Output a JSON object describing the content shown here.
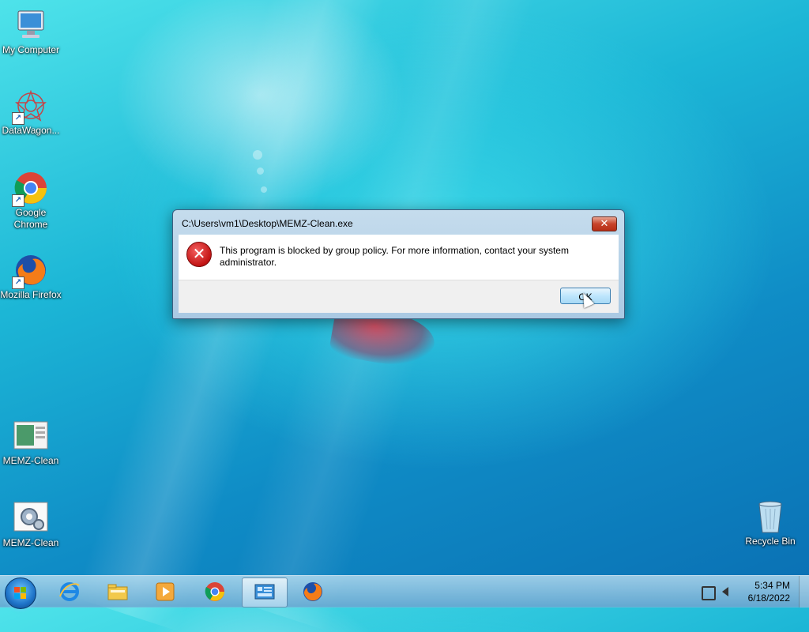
{
  "desktop": {
    "icons": [
      {
        "label": "My Computer",
        "icon": "computer-icon"
      },
      {
        "label": "DataWagon...",
        "icon": "datawagon-icon"
      },
      {
        "label": "Google Chrome",
        "icon": "chrome-icon"
      },
      {
        "label": "Mozilla Firefox",
        "icon": "firefox-icon"
      },
      {
        "label": "MEMZ-Clean",
        "icon": "memz-window-icon"
      },
      {
        "label": "MEMZ-Clean",
        "icon": "memz-gear-icon"
      },
      {
        "label": "Recycle Bin",
        "icon": "recycle-bin-icon"
      }
    ]
  },
  "dialog": {
    "title": "C:\\Users\\vm1\\Desktop\\MEMZ-Clean.exe",
    "close_glyph": "✕",
    "message": "This program is blocked by group policy. For more information, contact your system administrator.",
    "ok_label": "OK",
    "icon": "error-icon"
  },
  "taskbar": {
    "start_icon": "windows-start-icon",
    "pinned": [
      "internet-explorer-icon",
      "file-explorer-icon",
      "media-player-icon",
      "chrome-icon",
      "control-panel-icon",
      "firefox-icon"
    ],
    "active_index": 4,
    "clock": {
      "time": "5:34 PM",
      "date": "6/18/2022"
    }
  },
  "colors": {
    "desktop_accent": "#1cb6d6",
    "error_red": "#c21414",
    "close_red": "#c7432b"
  }
}
